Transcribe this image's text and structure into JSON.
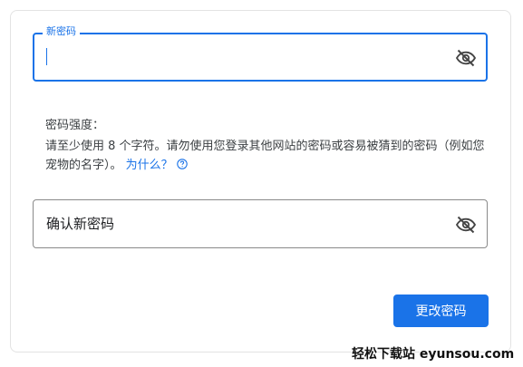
{
  "new_password": {
    "label": "新密码",
    "value": ""
  },
  "strength": {
    "label": "密码强度："
  },
  "hint": {
    "text": "请至少使用 8 个字符。请勿使用您登录其他网站的密码或容易被猜到的密码（例如您宠物的名字）。",
    "link": "为什么？"
  },
  "confirm_password": {
    "placeholder": "确认新密码"
  },
  "actions": {
    "submit_label": "更改密码"
  },
  "watermark": "轻松下载站 eyunsou.com",
  "icons": {
    "visibility_toggle": "eye-off-icon",
    "help": "help-circle-icon"
  },
  "colors": {
    "accent": "#1a73e8",
    "text": "#3c4043",
    "border": "#8a8a8a"
  }
}
